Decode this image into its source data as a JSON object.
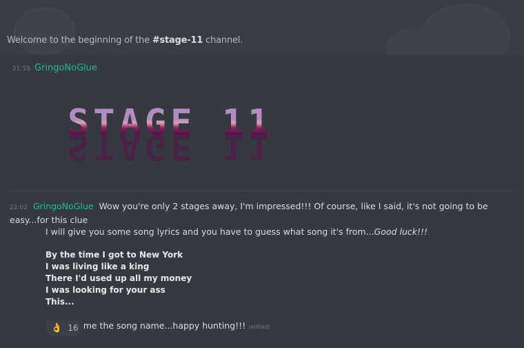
{
  "channel": {
    "welcome_prefix": "Welcome to the beginning of the ",
    "channel_name": "#stage-11",
    "welcome_suffix": " channel."
  },
  "messages": [
    {
      "timestamp": "21:55",
      "author": "GringoNoGlue",
      "image_alt": "STAGE 11"
    },
    {
      "timestamp": "22:02",
      "author": "GringoNoGlue",
      "text_line1": "Wow you're only 2 stages away, I'm impressed!!! Of course, like I said, it's not going to be easy...for this clue",
      "text_line2": "I will give you some song lyrics and you have to guess what song it's from...",
      "text_italic": "Good luck!!!",
      "lyrics": [
        "By the time I got to New York",
        "I was living like a king",
        "There I'd used up all my money",
        "I was looking for your ass",
        "This..."
      ],
      "closing": "Now tell me the song name...happy hunting!!! ",
      "edited": "(edited)",
      "reaction": {
        "emoji": "👌",
        "count": "16"
      }
    }
  ],
  "colors": {
    "background": "#36393f",
    "author": "#1abc9c",
    "art_top": "#b08ec2",
    "art_mid": "#e0a0b0",
    "art_bottom": "#5a1050"
  }
}
